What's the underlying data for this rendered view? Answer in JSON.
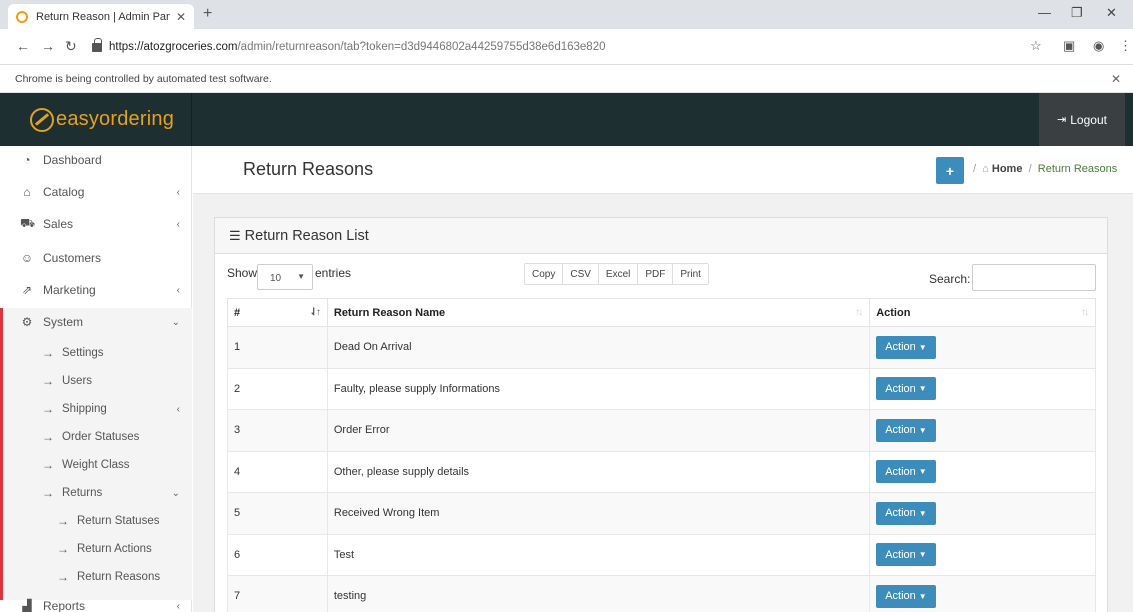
{
  "browser": {
    "tab_title": "Return Reason | Admin Panel - Pe",
    "url_host": "https://atozgroceries.com",
    "url_path": "/admin/returnreason/tab?token=d3d9446802a44259755d38e6d163e820",
    "automation_notice": "Chrome is being controlled by automated test software."
  },
  "header": {
    "brand": "easyordering",
    "logout_label": "Logout"
  },
  "sidebar": {
    "items": [
      {
        "label": "Dashboard",
        "icon": "dashboard-icon",
        "glyph": "◔",
        "caret": ""
      },
      {
        "label": "Catalog",
        "icon": "tag-icon",
        "glyph": "⌂",
        "caret": "‹"
      },
      {
        "label": "Sales",
        "icon": "cart-icon",
        "glyph": "⛟",
        "caret": "‹"
      },
      {
        "label": "Customers",
        "icon": "user-icon",
        "glyph": "☺",
        "caret": ""
      },
      {
        "label": "Marketing",
        "icon": "share-icon",
        "glyph": "⇗",
        "caret": "‹"
      },
      {
        "label": "System",
        "icon": "gear-icon",
        "glyph": "⚙",
        "caret": "⌄"
      },
      {
        "label": "Reports",
        "icon": "bar-chart-icon",
        "glyph": "▟",
        "caret": "‹"
      }
    ],
    "system_sub": [
      {
        "label": "Settings",
        "caret": ""
      },
      {
        "label": "Users",
        "caret": ""
      },
      {
        "label": "Shipping",
        "caret": "‹"
      },
      {
        "label": "Order Statuses",
        "caret": ""
      },
      {
        "label": "Weight Class",
        "caret": ""
      },
      {
        "label": "Returns",
        "caret": "⌄"
      }
    ],
    "returns_sub": [
      {
        "label": "Return Statuses"
      },
      {
        "label": "Return Actions"
      },
      {
        "label": "Return Reasons"
      }
    ],
    "arrow": "→"
  },
  "page": {
    "title": "Return Reasons",
    "add_label": "+",
    "breadcrumb_home": "Home",
    "breadcrumb_sep": "/",
    "breadcrumb_current": "Return Reasons"
  },
  "panel": {
    "title": "Return Reason List",
    "show_label": "Show",
    "page_length": "10",
    "entries_label": "entries",
    "search_label": "Search:",
    "export_buttons": [
      "Copy",
      "CSV",
      "Excel",
      "PDF",
      "Print"
    ]
  },
  "table": {
    "columns": [
      "#",
      "Return Reason Name",
      "Action"
    ],
    "action_label": "Action",
    "rows": [
      {
        "num": "1",
        "name": "Dead On Arrival"
      },
      {
        "num": "2",
        "name": "Faulty, please supply Informations"
      },
      {
        "num": "3",
        "name": "Order Error"
      },
      {
        "num": "4",
        "name": "Other, please supply details"
      },
      {
        "num": "5",
        "name": "Received Wrong Item"
      },
      {
        "num": "6",
        "name": "Test"
      },
      {
        "num": "7",
        "name": "testing"
      }
    ]
  },
  "colors": {
    "header_bg": "#1e2f32",
    "brand": "#e5a21c",
    "primary_button": "#3c8dbc",
    "active_border": "#d9363e",
    "breadcrumb_active": "#4a7d3a"
  }
}
